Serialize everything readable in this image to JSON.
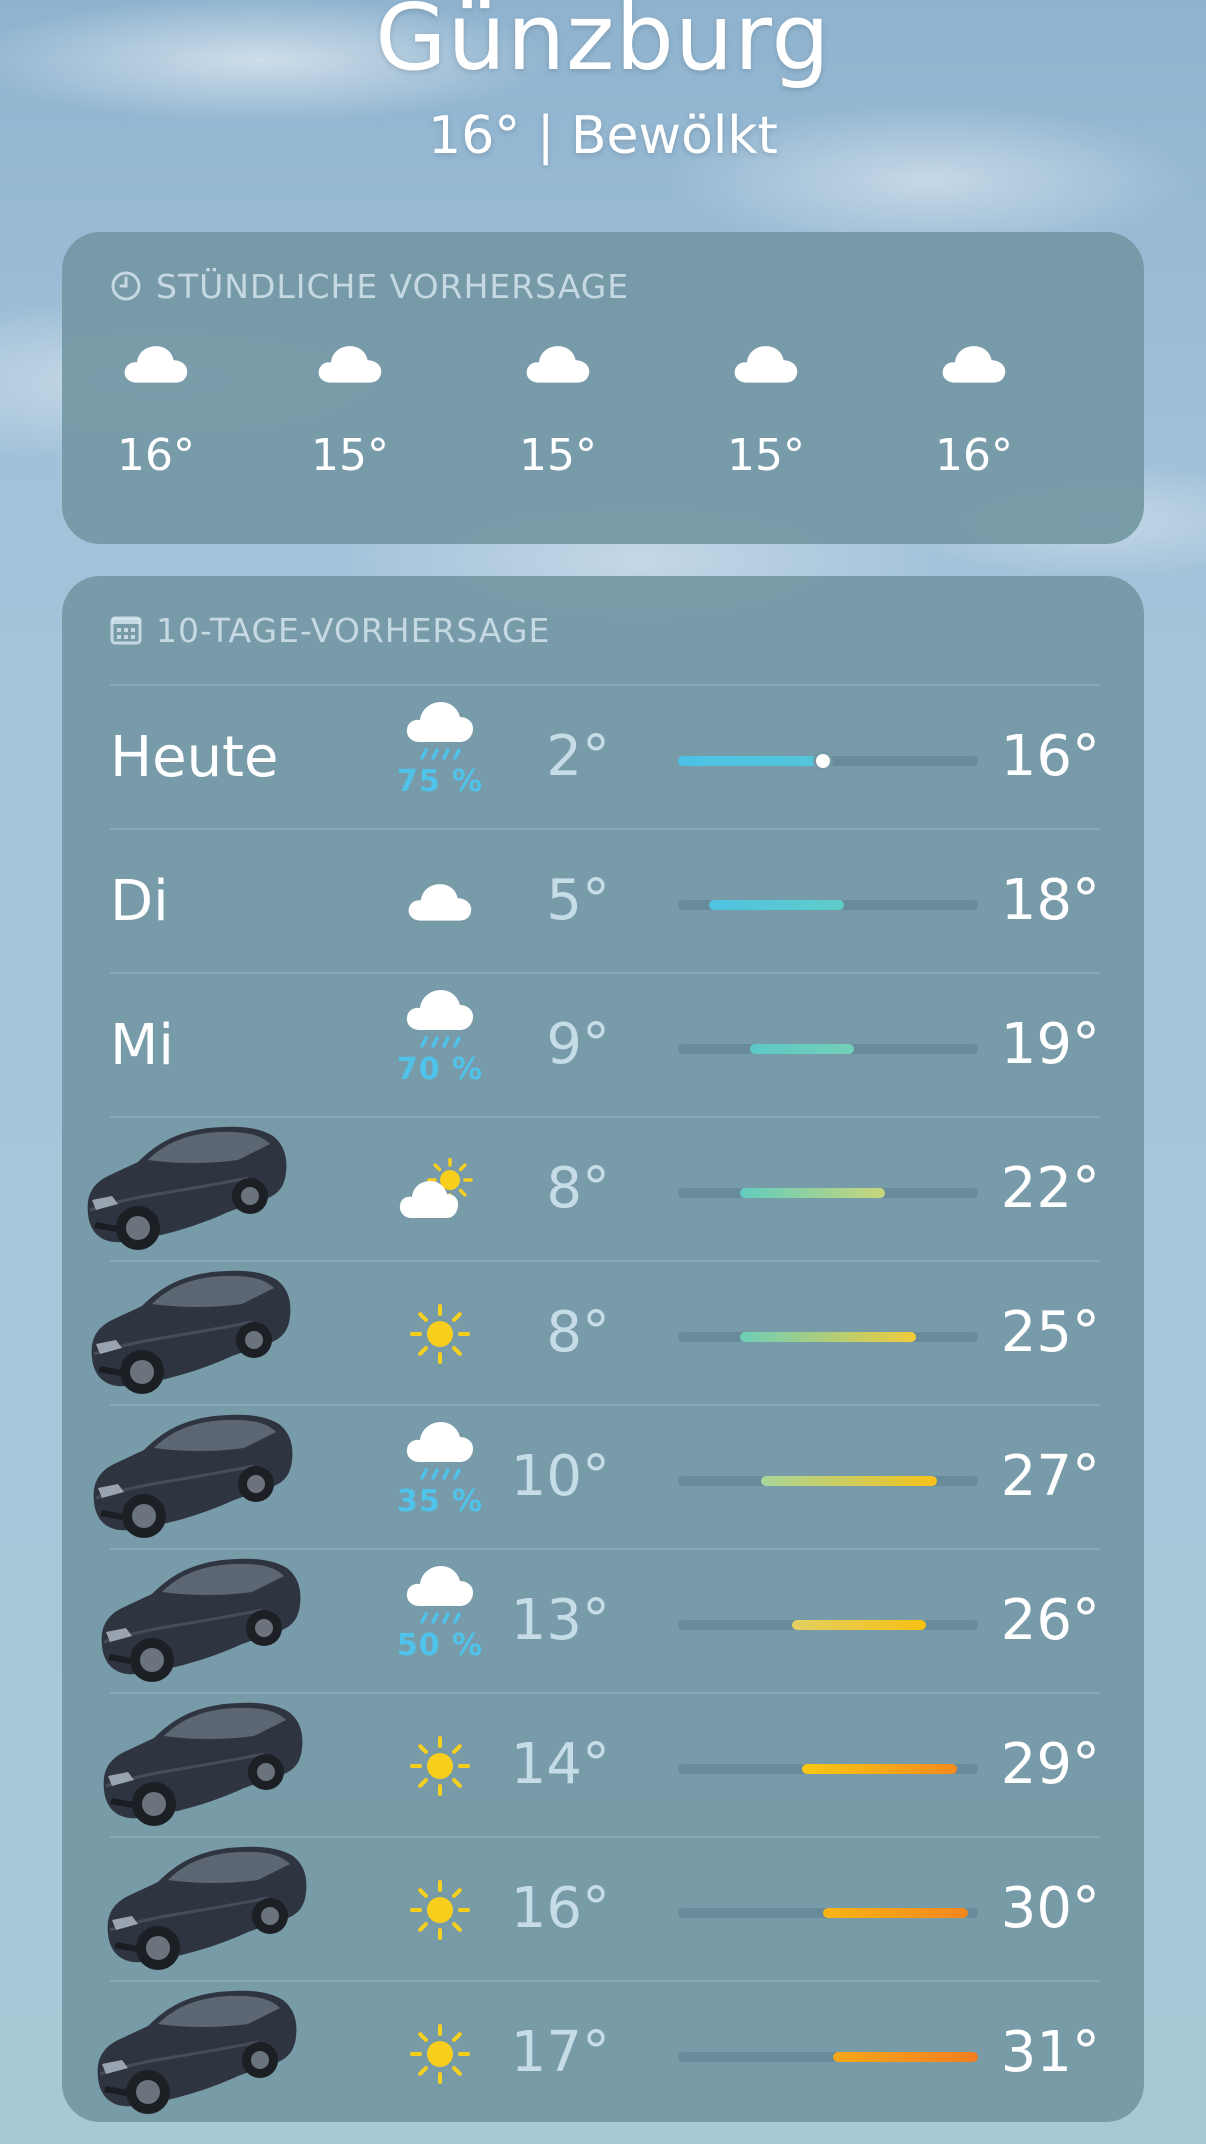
{
  "header": {
    "city": "Günzburg",
    "current": "16°  |  Bewölkt"
  },
  "hourly": {
    "title": "STÜNDLICHE VORHERSAGE",
    "icon": "clock-icon",
    "items": [
      {
        "icon": "cloud-icon",
        "temp": "16°"
      },
      {
        "icon": "cloud-icon",
        "temp": "15°"
      },
      {
        "icon": "cloud-icon",
        "temp": "15°"
      },
      {
        "icon": "cloud-icon",
        "temp": "15°"
      },
      {
        "icon": "cloud-icon",
        "temp": "16°"
      }
    ]
  },
  "daily": {
    "title": "10-TAGE-VORHERSAGE",
    "icon": "calendar-icon",
    "range_min": 2,
    "range_max": 31,
    "days": [
      {
        "label": "Heute",
        "icon": "cloud-rain-icon",
        "precip": "75 %",
        "min": "2°",
        "max": "16°",
        "low": 2,
        "high": 16,
        "current": 16,
        "grad": [
          "#4cc2e6",
          "#54c6da"
        ]
      },
      {
        "label": "Di",
        "icon": "cloud-icon",
        "precip": "",
        "min": "5°",
        "max": "18°",
        "low": 5,
        "high": 18,
        "grad": [
          "#4fc3e2",
          "#5fccc8"
        ]
      },
      {
        "label": "Mi",
        "icon": "cloud-rain-icon",
        "precip": "70 %",
        "min": "9°",
        "max": "19°",
        "low": 9,
        "high": 19,
        "grad": [
          "#5cc8c6",
          "#74d0b8"
        ]
      },
      {
        "label": "",
        "icon": "partly-cloudy-icon",
        "precip": "",
        "min": "8°",
        "max": "22°",
        "low": 8,
        "high": 22,
        "grad": [
          "#62ccbf",
          "#c9d67a"
        ]
      },
      {
        "label": "",
        "icon": "sun-icon",
        "precip": "",
        "min": "8°",
        "max": "25°",
        "low": 8,
        "high": 25,
        "grad": [
          "#6dceb9",
          "#f1cc3a"
        ]
      },
      {
        "label": "",
        "icon": "cloud-rain-icon",
        "precip": "35 %",
        "min": "10°",
        "max": "27°",
        "low": 10,
        "high": 27,
        "grad": [
          "#a8d69a",
          "#f7c21a"
        ]
      },
      {
        "label": "",
        "icon": "cloud-rain-icon",
        "precip": "50 %",
        "min": "13°",
        "max": "26°",
        "low": 13,
        "high": 26,
        "grad": [
          "#e2d063",
          "#f8c012"
        ]
      },
      {
        "label": "",
        "icon": "sun-icon",
        "precip": "",
        "min": "14°",
        "max": "29°",
        "low": 14,
        "high": 29,
        "grad": [
          "#f8c914",
          "#f58a1e"
        ]
      },
      {
        "label": "",
        "icon": "sun-icon",
        "precip": "",
        "min": "16°",
        "max": "30°",
        "low": 16,
        "high": 30,
        "grad": [
          "#f7b515",
          "#f4861f"
        ]
      },
      {
        "label": "",
        "icon": "sun-icon",
        "precip": "",
        "min": "17°",
        "max": "31°",
        "low": 17,
        "high": 31,
        "grad": [
          "#f6a71a",
          "#f37e20"
        ]
      }
    ]
  },
  "colors": {
    "precip": "#4fc3ea",
    "sun": "#f7cf1c",
    "card": "#7598a5"
  }
}
